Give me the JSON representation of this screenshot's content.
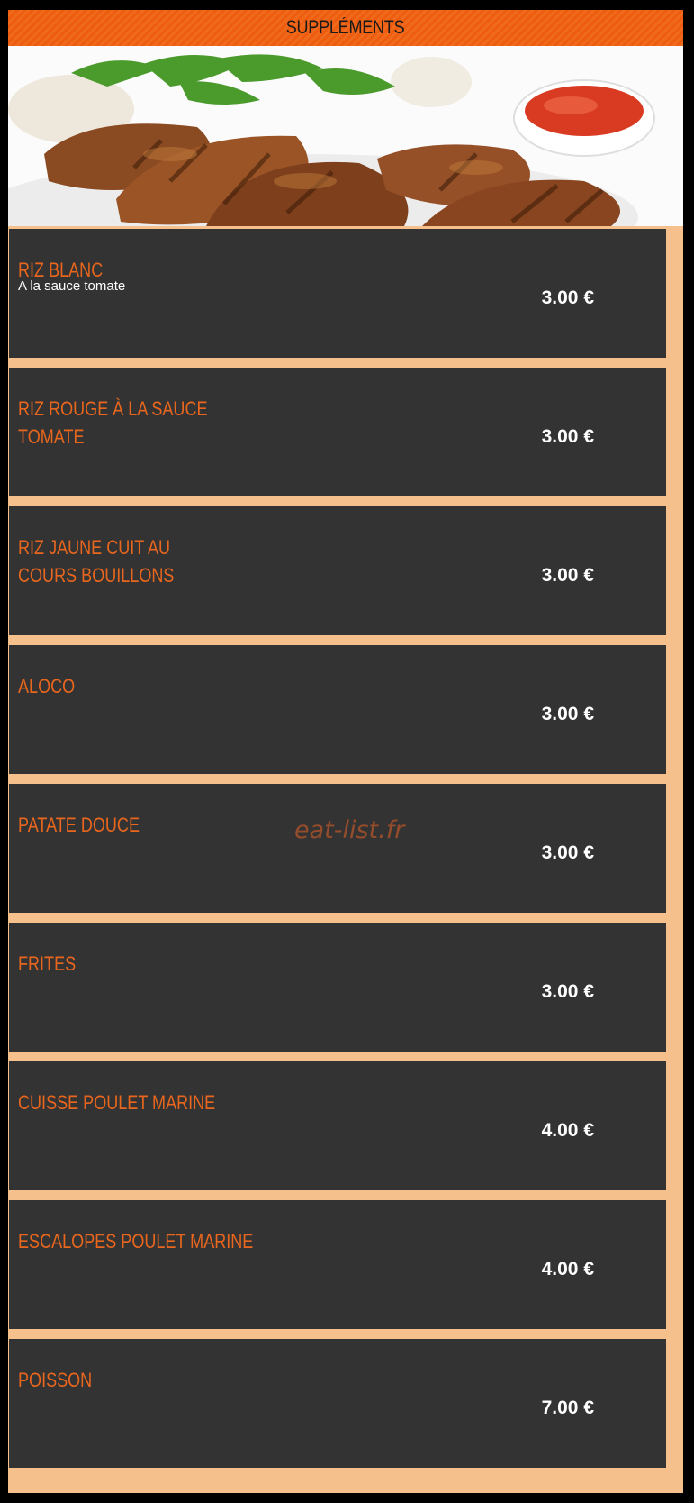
{
  "header": {
    "title": "SUPPLÉMENTS"
  },
  "hero": {
    "image": "grilled-chicken-with-herbs-rice-and-tomato-sauce"
  },
  "items": [
    {
      "name": "RIZ BLANC",
      "description": "A la sauce tomate",
      "price": "3.00 €"
    },
    {
      "name": "RIZ ROUGE À LA SAUCE TOMATE",
      "description": "",
      "price": "3.00 €"
    },
    {
      "name": "RIZ JAUNE CUIT AU COURS BOUILLONS",
      "description": "",
      "price": "3.00 €"
    },
    {
      "name": "ALOCO",
      "description": "",
      "price": "3.00 €"
    },
    {
      "name": "PATATE DOUCE",
      "description": "",
      "price": "3.00 €"
    },
    {
      "name": "FRITES",
      "description": "",
      "price": "3.00 €"
    },
    {
      "name": "CUISSE POULET MARINE",
      "description": "",
      "price": "4.00 €"
    },
    {
      "name": "ESCALOPES POULET MARINE",
      "description": "",
      "price": "4.00 €"
    },
    {
      "name": "POISSON",
      "description": "",
      "price": "7.00 €"
    }
  ],
  "watermark": "eat-list.fr",
  "colors": {
    "accent": "#e8661d",
    "header_bg": "#ee5c10",
    "card_bg": "#333333",
    "frame_bg": "#f6c08c"
  }
}
